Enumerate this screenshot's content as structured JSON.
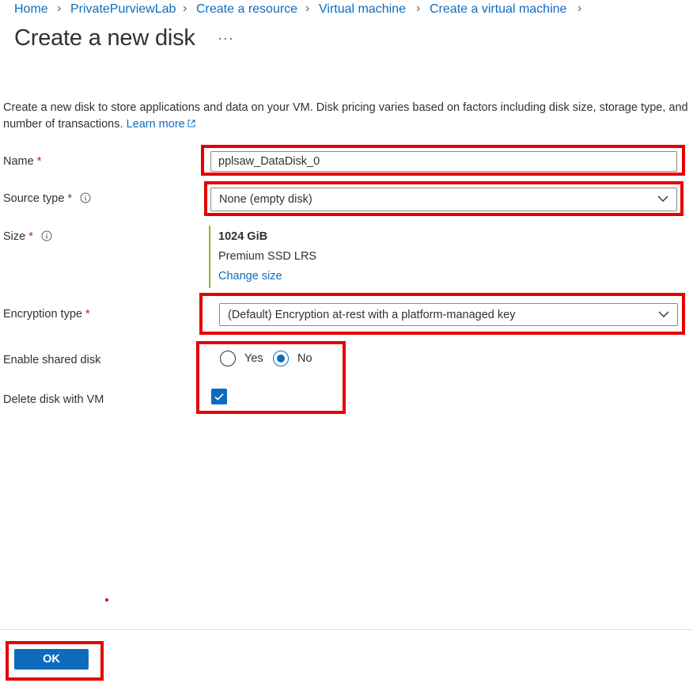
{
  "breadcrumb": [
    {
      "label": "Home"
    },
    {
      "label": "PrivatePurviewLab"
    },
    {
      "label": "Create a resource"
    },
    {
      "label": "Virtual machine"
    },
    {
      "label": "Create a virtual machine"
    }
  ],
  "page_title": "Create a new disk",
  "more_label": "···",
  "description": {
    "text": "Create a new disk to store applications and data on your VM. Disk pricing varies based on factors including disk size, storage type, and number of transactions.",
    "learn_more": "Learn more"
  },
  "form": {
    "name": {
      "label": "Name",
      "required": "*",
      "value": "pplsaw_DataDisk_0"
    },
    "source_type": {
      "label": "Source type",
      "required": "*",
      "value": "None (empty disk)"
    },
    "size": {
      "label": "Size",
      "required": "*",
      "value": "1024 GiB",
      "sku": "Premium SSD LRS",
      "change_label": "Change size"
    },
    "encryption_type": {
      "label": "Encryption type",
      "required": "*",
      "value": "(Default) Encryption at-rest with a platform-managed key"
    },
    "shared_disk": {
      "label": "Enable shared disk",
      "options": [
        "Yes",
        "No"
      ],
      "selected": "No"
    },
    "delete_with_vm": {
      "label": "Delete disk with VM",
      "checked": true
    }
  },
  "footer": {
    "ok_label": "OK"
  },
  "colors": {
    "accent": "#0f6cbd",
    "required": "#a4262c",
    "highlight": "#e60000",
    "size_bar": "#8cbd18"
  },
  "icons": [
    "chevron-right-icon",
    "info-icon",
    "external-link-icon",
    "chevron-down-icon",
    "checkmark-icon"
  ]
}
